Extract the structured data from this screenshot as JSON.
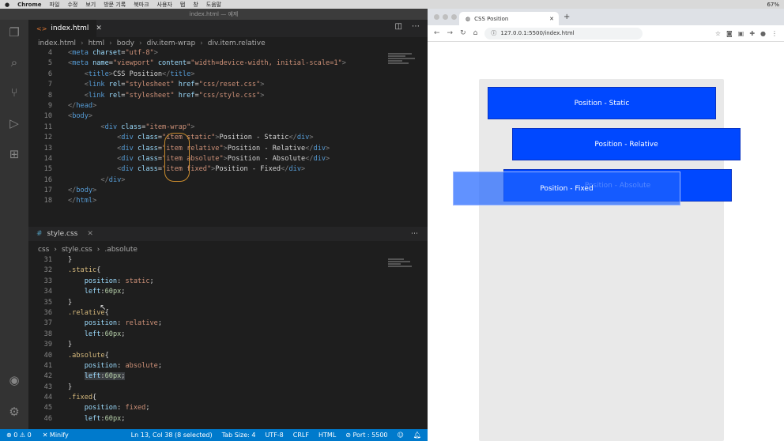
{
  "menubar": {
    "app": "Chrome",
    "items": [
      "파일",
      "수정",
      "보기",
      "방문 기록",
      "북마크",
      "사용자",
      "탭",
      "창",
      "도움말"
    ],
    "battery": "67%"
  },
  "vscode": {
    "title": "index.html — 예제",
    "tab1": {
      "label": "index.html"
    },
    "crumbs": [
      "index.html",
      "html",
      "body",
      "div.item-wrap",
      "div.item.relative"
    ],
    "tab2": {
      "label": "style.css"
    },
    "crumbs2": [
      "css",
      "style.css",
      ".absolute"
    ]
  },
  "html_code": [
    {
      "n": "4",
      "tokens": [
        [
          "br",
          "<"
        ],
        [
          "tag",
          "meta "
        ],
        [
          "attr",
          "charset"
        ],
        [
          "txt",
          "="
        ],
        [
          "str",
          "\"utf-8\""
        ],
        [
          "br",
          ">"
        ]
      ]
    },
    {
      "n": "5",
      "tokens": [
        [
          "br",
          "<"
        ],
        [
          "tag",
          "meta "
        ],
        [
          "attr",
          "name"
        ],
        [
          "txt",
          "="
        ],
        [
          "str",
          "\"viewport\" "
        ],
        [
          "attr",
          "content"
        ],
        [
          "txt",
          "="
        ],
        [
          "str",
          "\"width=device-width, initial-scale=1\""
        ],
        [
          "br",
          ">"
        ]
      ]
    },
    {
      "n": "6",
      "tokens": [
        [
          "txt",
          "    "
        ],
        [
          "br",
          "<"
        ],
        [
          "tag",
          "title"
        ],
        [
          "br",
          ">"
        ],
        [
          "txt",
          "CSS Position"
        ],
        [
          "br",
          "</"
        ],
        [
          "tag",
          "title"
        ],
        [
          "br",
          ">"
        ]
      ]
    },
    {
      "n": "7",
      "tokens": [
        [
          "txt",
          "    "
        ],
        [
          "br",
          "<"
        ],
        [
          "tag",
          "link "
        ],
        [
          "attr",
          "rel"
        ],
        [
          "txt",
          "="
        ],
        [
          "str",
          "\"stylesheet\" "
        ],
        [
          "attr",
          "href"
        ],
        [
          "txt",
          "="
        ],
        [
          "str",
          "\"css/reset.css\""
        ],
        [
          "br",
          ">"
        ]
      ]
    },
    {
      "n": "8",
      "tokens": [
        [
          "txt",
          "    "
        ],
        [
          "br",
          "<"
        ],
        [
          "tag",
          "link "
        ],
        [
          "attr",
          "rel"
        ],
        [
          "txt",
          "="
        ],
        [
          "str",
          "\"stylesheet\" "
        ],
        [
          "attr",
          "href"
        ],
        [
          "txt",
          "="
        ],
        [
          "str",
          "\"css/style.css\""
        ],
        [
          "br",
          ">"
        ]
      ]
    },
    {
      "n": "9",
      "tokens": [
        [
          "br",
          "</"
        ],
        [
          "tag",
          "head"
        ],
        [
          "br",
          ">"
        ]
      ]
    },
    {
      "n": "10",
      "tokens": [
        [
          "br",
          "<"
        ],
        [
          "tag",
          "body"
        ],
        [
          "br",
          ">"
        ]
      ]
    },
    {
      "n": "11",
      "tokens": [
        [
          "txt",
          "        "
        ],
        [
          "br",
          "<"
        ],
        [
          "tag",
          "div "
        ],
        [
          "attr",
          "class"
        ],
        [
          "txt",
          "="
        ],
        [
          "str",
          "\"item-wrap\""
        ],
        [
          "br",
          ">"
        ]
      ]
    },
    {
      "n": "12",
      "tokens": [
        [
          "txt",
          "            "
        ],
        [
          "br",
          "<"
        ],
        [
          "tag",
          "div "
        ],
        [
          "attr",
          "class"
        ],
        [
          "txt",
          "="
        ],
        [
          "str",
          "\"item static\""
        ],
        [
          "br",
          ">"
        ],
        [
          "txt",
          "Position - Static"
        ],
        [
          "br",
          "</"
        ],
        [
          "tag",
          "div"
        ],
        [
          "br",
          ">"
        ]
      ]
    },
    {
      "n": "13",
      "tokens": [
        [
          "txt",
          "            "
        ],
        [
          "br",
          "<"
        ],
        [
          "tag",
          "div "
        ],
        [
          "attr",
          "class"
        ],
        [
          "txt",
          "="
        ],
        [
          "str",
          "\"item relative\""
        ],
        [
          "br",
          ">"
        ],
        [
          "txt",
          "Position - Relative"
        ],
        [
          "br",
          "</"
        ],
        [
          "tag",
          "div"
        ],
        [
          "br",
          ">"
        ]
      ]
    },
    {
      "n": "14",
      "tokens": [
        [
          "txt",
          "            "
        ],
        [
          "br",
          "<"
        ],
        [
          "tag",
          "div "
        ],
        [
          "attr",
          "class"
        ],
        [
          "txt",
          "="
        ],
        [
          "str",
          "\"item absolute\""
        ],
        [
          "br",
          ">"
        ],
        [
          "txt",
          "Position - Absolute"
        ],
        [
          "br",
          "</"
        ],
        [
          "tag",
          "div"
        ],
        [
          "br",
          ">"
        ]
      ]
    },
    {
      "n": "15",
      "tokens": [
        [
          "txt",
          "            "
        ],
        [
          "br",
          "<"
        ],
        [
          "tag",
          "div "
        ],
        [
          "attr",
          "class"
        ],
        [
          "txt",
          "="
        ],
        [
          "str",
          "\"item fixed\""
        ],
        [
          "br",
          ">"
        ],
        [
          "txt",
          "Position - Fixed"
        ],
        [
          "br",
          "</"
        ],
        [
          "tag",
          "div"
        ],
        [
          "br",
          ">"
        ]
      ]
    },
    {
      "n": "16",
      "tokens": [
        [
          "txt",
          "        "
        ],
        [
          "br",
          "</"
        ],
        [
          "tag",
          "div"
        ],
        [
          "br",
          ">"
        ]
      ]
    },
    {
      "n": "17",
      "tokens": [
        [
          "br",
          "</"
        ],
        [
          "tag",
          "body"
        ],
        [
          "br",
          ">"
        ]
      ]
    },
    {
      "n": "18",
      "tokens": [
        [
          "br",
          "</"
        ],
        [
          "tag",
          "html"
        ],
        [
          "br",
          ">"
        ]
      ]
    }
  ],
  "css_code": [
    {
      "n": "31",
      "tokens": [
        [
          "txt",
          "}"
        ]
      ]
    },
    {
      "n": "32",
      "tokens": [
        [
          "sel",
          ".static"
        ],
        [
          "txt",
          "{"
        ]
      ]
    },
    {
      "n": "33",
      "tokens": [
        [
          "txt",
          "    "
        ],
        [
          "prop",
          "position"
        ],
        [
          "txt",
          ": "
        ],
        [
          "val",
          "static"
        ],
        [
          "txt",
          ";"
        ]
      ]
    },
    {
      "n": "34",
      "tokens": [
        [
          "txt",
          "    "
        ],
        [
          "prop",
          "left"
        ],
        [
          "txt",
          ":"
        ],
        [
          "num",
          "60px"
        ],
        [
          "txt",
          ";"
        ]
      ]
    },
    {
      "n": "35",
      "tokens": [
        [
          "txt",
          "}"
        ]
      ]
    },
    {
      "n": "36",
      "tokens": [
        [
          "sel",
          ".relative"
        ],
        [
          "txt",
          "{"
        ]
      ]
    },
    {
      "n": "37",
      "tokens": [
        [
          "txt",
          "    "
        ],
        [
          "prop",
          "position"
        ],
        [
          "txt",
          ": "
        ],
        [
          "val",
          "relative"
        ],
        [
          "txt",
          ";"
        ]
      ]
    },
    {
      "n": "38",
      "tokens": [
        [
          "txt",
          "    "
        ],
        [
          "prop",
          "left"
        ],
        [
          "txt",
          ":"
        ],
        [
          "num",
          "60px"
        ],
        [
          "txt",
          ";"
        ]
      ]
    },
    {
      "n": "39",
      "tokens": [
        [
          "txt",
          "}"
        ]
      ]
    },
    {
      "n": "40",
      "tokens": [
        [
          "sel",
          ".absolute"
        ],
        [
          "txt",
          "{"
        ]
      ]
    },
    {
      "n": "41",
      "tokens": [
        [
          "txt",
          "    "
        ],
        [
          "prop",
          "position"
        ],
        [
          "txt",
          ": "
        ],
        [
          "val",
          "absolute"
        ],
        [
          "txt",
          ";"
        ]
      ]
    },
    {
      "n": "42",
      "tokens": [
        [
          "txt",
          "    "
        ],
        [
          "prop",
          "left"
        ],
        [
          "txt",
          ":"
        ],
        [
          "num",
          "60px"
        ],
        [
          "txt",
          ";"
        ]
      ]
    },
    {
      "n": "43",
      "tokens": [
        [
          "txt",
          "}"
        ]
      ]
    },
    {
      "n": "44",
      "tokens": [
        [
          "sel",
          ".fixed"
        ],
        [
          "txt",
          "{"
        ]
      ]
    },
    {
      "n": "45",
      "tokens": [
        [
          "txt",
          "    "
        ],
        [
          "prop",
          "position"
        ],
        [
          "txt",
          ": "
        ],
        [
          "val",
          "fixed"
        ],
        [
          "txt",
          ";"
        ]
      ]
    },
    {
      "n": "46",
      "tokens": [
        [
          "txt",
          "    "
        ],
        [
          "prop",
          "left"
        ],
        [
          "txt",
          ":"
        ],
        [
          "num",
          "60px"
        ],
        [
          "txt",
          ";"
        ]
      ]
    }
  ],
  "statusbar": {
    "errors": "⊗ 0 ⚠ 0",
    "minify": "✕ Minify",
    "position": "Ln 13, Col 38 (8 selected)",
    "tabsize": "Tab Size: 4",
    "encoding": "UTF-8",
    "eol": "CRLF",
    "lang": "HTML",
    "port": "⊘ Port : 5500"
  },
  "browser": {
    "tab_title": "CSS Position",
    "url": "127.0.0.1:5500/index.html",
    "items": {
      "static": "Position - Static",
      "relative": "Position - Relative",
      "absolute": "Position - Absolute",
      "fixed": "Position - Fixed"
    }
  },
  "colors": {
    "accent": "#007acc",
    "item_blue": "#0048ff"
  }
}
